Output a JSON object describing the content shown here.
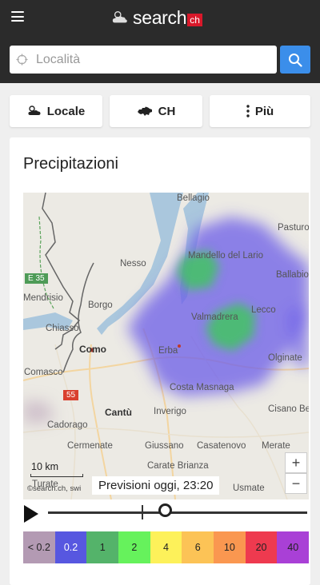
{
  "header": {
    "logo_text": "search",
    "logo_suffix": "ch"
  },
  "search": {
    "placeholder": "Località"
  },
  "tabs": [
    {
      "label": "Locale",
      "icon": "weather-icon"
    },
    {
      "label": "CH",
      "icon": "switzerland-icon"
    },
    {
      "label": "Più",
      "icon": "more-vertical-icon"
    }
  ],
  "precip": {
    "title": "Precipitazioni",
    "places": [
      "Bellagio",
      "Pasturo",
      "Nesso",
      "Mandello del Lario",
      "Ballabio",
      "Mendrisio",
      "Borgo",
      "Chiasso",
      "Como",
      "Lecco",
      "Erba",
      "Valmadrera",
      "Comasco",
      "Olginate",
      "Costa Masnaga",
      "Cantù",
      "Inverigo",
      "Cisano Ber",
      "Cadorago",
      "Cermenate",
      "Giussano",
      "Casatenovo",
      "Merate",
      "Carate Brianza",
      "Usmate",
      "Turate"
    ],
    "motorway_labels": [
      "E 35",
      "55"
    ],
    "scale_label": "10 km",
    "attribution": "©search.ch, swi",
    "forecast_label": "Previsioni oggi, 23:20",
    "zoom_in": "+",
    "zoom_out": "−",
    "timeline_progress": 0.45,
    "legend": [
      {
        "label": "< 0.2",
        "color": "#b39ab3"
      },
      {
        "label": "0.2",
        "color": "#5757e0"
      },
      {
        "label": "1",
        "color": "#54b36a"
      },
      {
        "label": "2",
        "color": "#66f25c"
      },
      {
        "label": "4",
        "color": "#fdf15a"
      },
      {
        "label": "6",
        "color": "#fcc356"
      },
      {
        "label": "10",
        "color": "#fa9750"
      },
      {
        "label": "20",
        "color": "#ee3a4f"
      },
      {
        "label": "40",
        "color": "#a940d6"
      }
    ],
    "colors": {
      "light_rain": "#6f62e8",
      "moderate_rain": "#45c06a",
      "lake": "#aac7dd"
    }
  }
}
